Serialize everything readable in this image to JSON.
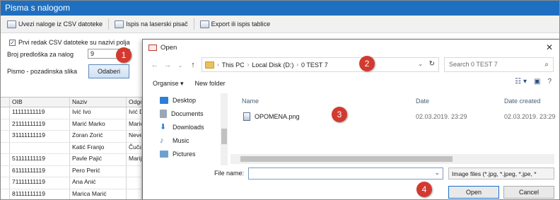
{
  "app": {
    "title": "Pisma s nalogom",
    "toolbar": [
      {
        "label": "Uvezi naloge iz CSV datoteke",
        "icon": "import-icon"
      },
      {
        "label": "Ispis na laserski pisač",
        "icon": "printer-icon"
      },
      {
        "label": "Export ili ispis tablice",
        "icon": "export-icon"
      }
    ],
    "options": {
      "header_checkbox_label": "Prvi redak CSV datoteke su nazivi polja",
      "header_checkbox_checked": true,
      "template_number_label": "Broj predloška za nalog",
      "template_number_value": "9",
      "background_label": "Pismo - pozadinska slika",
      "choose_button": "Odaberi"
    },
    "grid": {
      "columns": [
        "OIB",
        "Naziv",
        "Odgo"
      ],
      "rows": [
        [
          "11111111119",
          "Ivić Ivo",
          "Ivić D"
        ],
        [
          "21111111119",
          "Marić Marko",
          "Marić"
        ],
        [
          "31111111119",
          "Zoran Zorić",
          "Neve"
        ],
        [
          "",
          "Katić Franjo",
          "Čuča"
        ],
        [
          "51111111119",
          "Pavle Pajić",
          "Marij"
        ],
        [
          "61111111119",
          "Pero Perić",
          ""
        ],
        [
          "71111111119",
          "Ana Anić",
          ""
        ],
        [
          "81111111119",
          "Marica Marić",
          ""
        ]
      ]
    }
  },
  "dialog": {
    "title": "Open",
    "breadcrumb": [
      "This PC",
      "Local Disk (D:)",
      "0 TEST 7"
    ],
    "search_placeholder": "Search 0 TEST 7",
    "organise_label": "Organise ▾",
    "new_folder_label": "New folder",
    "nav_items": [
      {
        "label": "Desktop",
        "icon": "desktop-icon",
        "color": "#2b7fd6"
      },
      {
        "label": "Documents",
        "icon": "documents-icon",
        "color": "#9aa7b6"
      },
      {
        "label": "Downloads",
        "icon": "downloads-icon",
        "color": "#2b7fd6"
      },
      {
        "label": "Music",
        "icon": "music-icon",
        "color": "#2b7fd6"
      },
      {
        "label": "Pictures",
        "icon": "pictures-icon",
        "color": "#6fa0d2"
      }
    ],
    "columns": {
      "name": "Name",
      "date": "Date",
      "created": "Date created"
    },
    "files": [
      {
        "name": "OPOMENA.png",
        "date": "02.03.2019. 23:29",
        "created": "02.03.2019. 23:29"
      }
    ],
    "file_name_label": "File name:",
    "file_name_value": "",
    "file_type": "Image files (*.jpg, *.jpeg, *.jpe, *",
    "open_button": "Open",
    "cancel_button": "Cancel"
  },
  "steps": [
    "1",
    "2",
    "3",
    "4"
  ],
  "colors": {
    "step_marker": "#d23a30",
    "title_bar": "#1f6fc0",
    "folder": "#e9c25e"
  }
}
